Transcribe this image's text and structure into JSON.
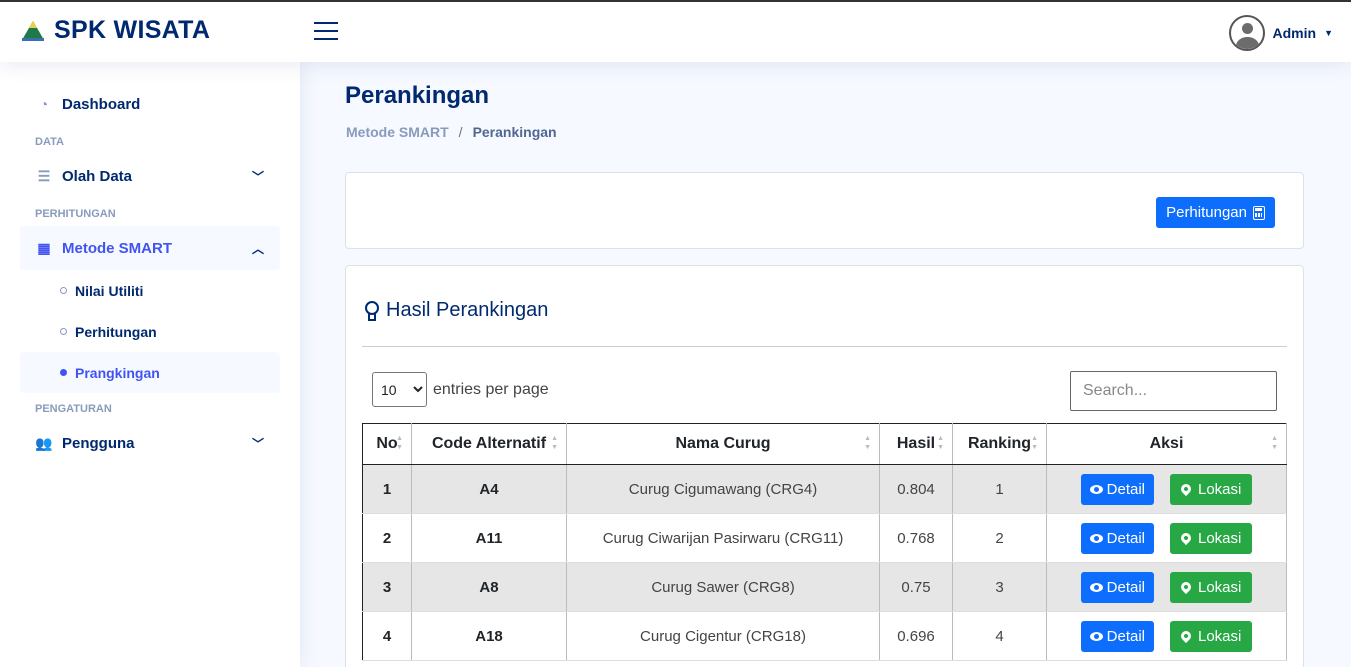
{
  "header": {
    "app_title": "SPK WISATA",
    "user_name": "Admin",
    "logo_icon": "mountain-logo-icon",
    "menu_icon": "hamburger-icon"
  },
  "sidebar": {
    "dashboard": "Dashboard",
    "heading_data": "DATA",
    "olah_data": "Olah Data",
    "heading_perhitungan": "PERHITUNGAN",
    "metode_smart": "Metode SMART",
    "sub_items": [
      "Nilai Utiliti",
      "Perhitungan",
      "Prangkingan"
    ],
    "heading_pengaturan": "PENGATURAN",
    "pengguna": "Pengguna",
    "active_color": "#4154f1"
  },
  "page": {
    "title": "Perankingan",
    "breadcrumb_parent": "Metode SMART",
    "breadcrumb_sep": "/",
    "breadcrumb_current": "Perankingan",
    "perhitungan_button": "Perhitungan"
  },
  "results": {
    "title": "Hasil Perankingan",
    "entries_value": "10",
    "entries_label": "entries per page",
    "search_placeholder": "Search...",
    "columns": [
      "No",
      "Code Alternatif",
      "Nama Curug",
      "Hasil",
      "Ranking",
      "Aksi"
    ],
    "rows": [
      {
        "no": "1",
        "code": "A4",
        "nama": "Curug Cigumawang (CRG4)",
        "hasil": "0.804",
        "ranking": "1"
      },
      {
        "no": "2",
        "code": "A11",
        "nama": "Curug Ciwarijan Pasirwaru (CRG11)",
        "hasil": "0.768",
        "ranking": "2"
      },
      {
        "no": "3",
        "code": "A8",
        "nama": "Curug Sawer (CRG8)",
        "hasil": "0.75",
        "ranking": "3"
      },
      {
        "no": "4",
        "code": "A18",
        "nama": "Curug Cigentur (CRG18)",
        "hasil": "0.696",
        "ranking": "4"
      }
    ],
    "detail_label": "Detail",
    "lokasi_label": "Lokasi",
    "detail_color": "#0d6efd",
    "lokasi_color": "#28a745"
  }
}
